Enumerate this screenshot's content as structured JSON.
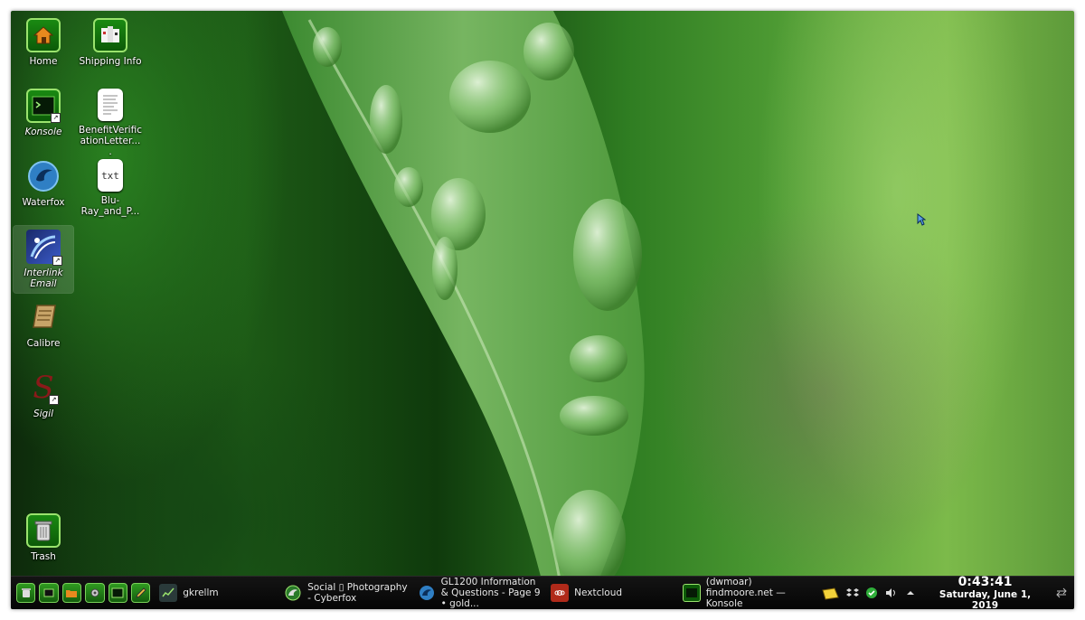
{
  "desktop": {
    "icons": [
      {
        "label": "Home"
      },
      {
        "label": "Shipping Info"
      },
      {
        "label": "Konsole"
      },
      {
        "label": "BenefitVerificationLetter...."
      },
      {
        "label": "Waterfox"
      },
      {
        "label": "Blu-Ray_and_P..."
      },
      {
        "label": "Interlink Email"
      },
      {
        "label": "Calibre"
      },
      {
        "label": "Sigil"
      },
      {
        "label": "Trash"
      }
    ],
    "doc_badge": "txt"
  },
  "taskbar": {
    "tasks": [
      {
        "label": "gkrellm"
      },
      {
        "label": "Social ▯ Photography - Cyberfox"
      },
      {
        "label": "GL1200 Information & Questions - Page 9 • gold..."
      },
      {
        "label": "Nextcloud"
      },
      {
        "label": "(dwmoar) findmoore.net — Konsole"
      }
    ],
    "clock": {
      "time": "0:43:41",
      "date": "Saturday, June 1, 2019"
    }
  },
  "colors": {
    "accent_green": "#1a8a12",
    "panel_bg": "#0a0a0a"
  }
}
